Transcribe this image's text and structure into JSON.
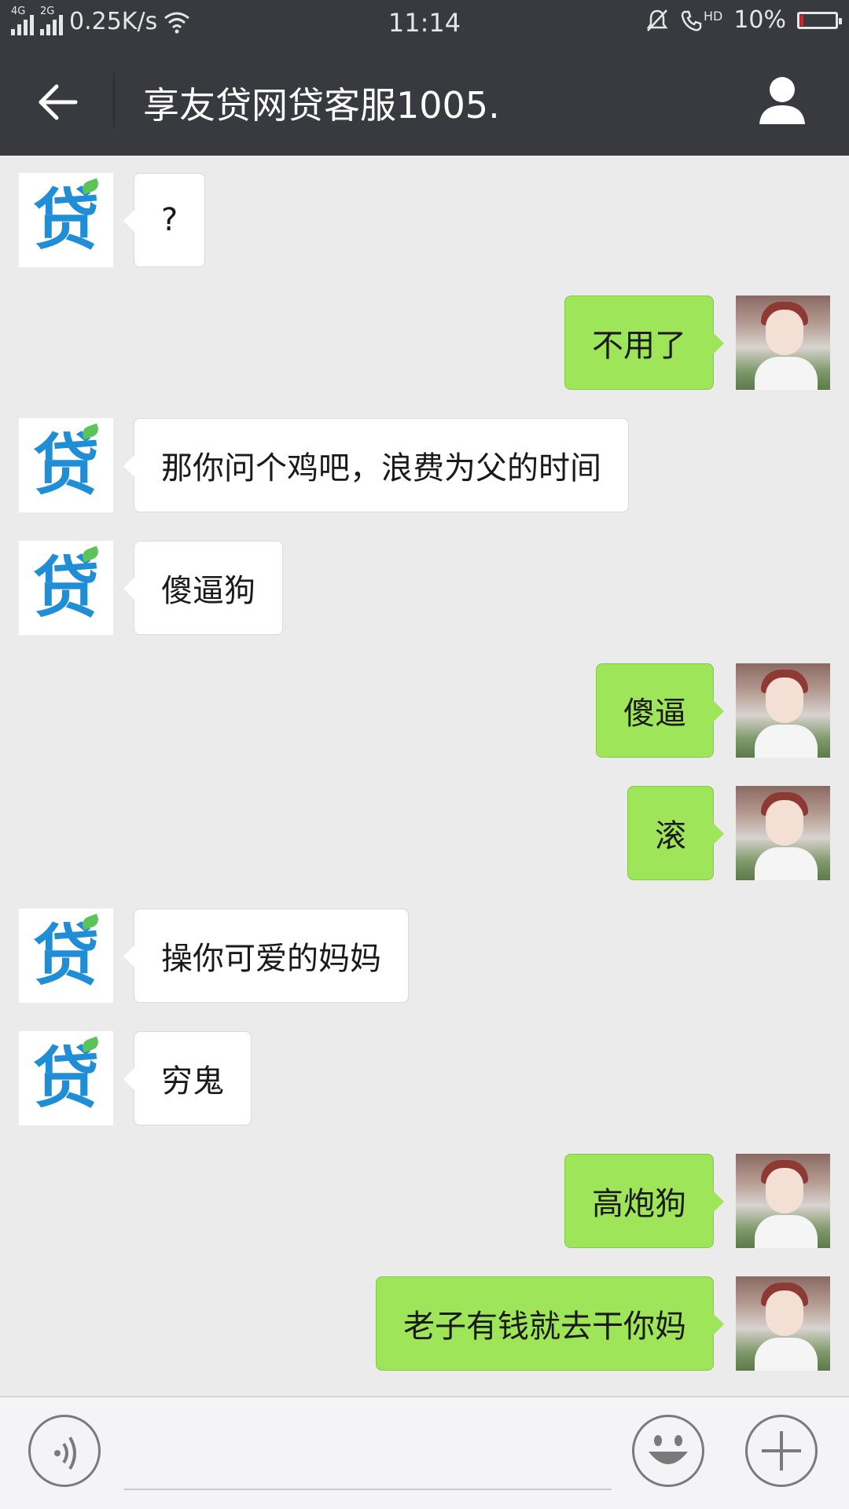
{
  "status_bar": {
    "network_1": "4G",
    "network_2": "2G",
    "speed": "0.25K/s",
    "time": "11:14",
    "hd": "HD",
    "battery": "10%",
    "battery_level": 0.1
  },
  "header": {
    "title": "享友贷网贷客服1005."
  },
  "messages": [
    {
      "side": "in",
      "text": "?"
    },
    {
      "side": "out",
      "text": "不用了"
    },
    {
      "side": "in",
      "text": "那你问个鸡吧，浪费为父的时间"
    },
    {
      "side": "in",
      "text": "傻逼狗"
    },
    {
      "side": "out",
      "text": "傻逼"
    },
    {
      "side": "out",
      "text": "滚"
    },
    {
      "side": "in",
      "text": "操你可爱的妈妈"
    },
    {
      "side": "in",
      "text": "穷鬼"
    },
    {
      "side": "out",
      "text": "高炮狗"
    },
    {
      "side": "out",
      "text": "老子有钱就去干你妈"
    }
  ],
  "contact_avatar_text": "贷",
  "colors": {
    "header_bg": "#393a3f",
    "chat_bg": "#ebebeb",
    "outgoing_bubble": "#9fe55a",
    "incoming_bubble": "#ffffff",
    "logo_blue": "#1f8ed6"
  },
  "icons": {
    "back": "arrow-left-icon",
    "profile": "person-icon",
    "voice": "voice-icon",
    "emoji": "smiley-icon",
    "more": "plus-icon"
  }
}
